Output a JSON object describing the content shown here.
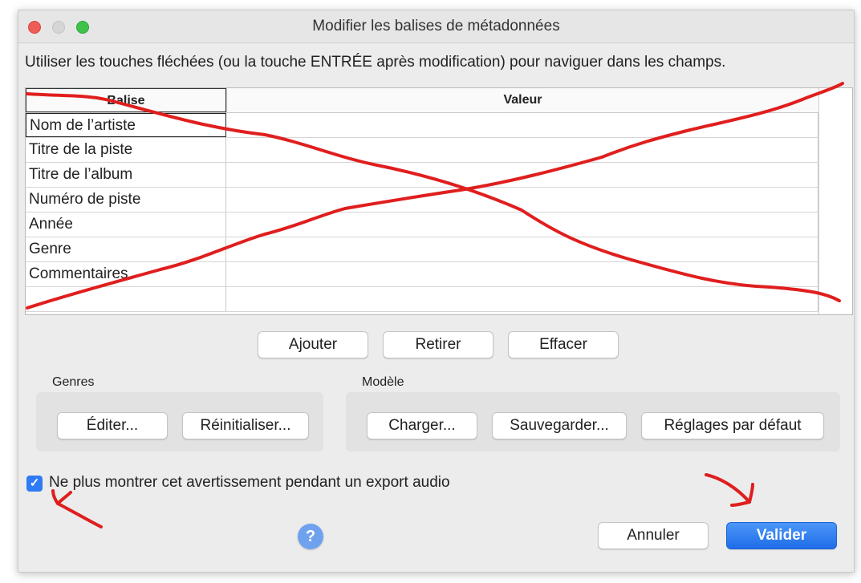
{
  "window": {
    "title": "Modifier les balises de métadonnées"
  },
  "instructions": "Utiliser les touches fléchées (ou la touche ENTRÉE après modification) pour naviguer dans les champs.",
  "table": {
    "headers": {
      "tag": "Balise",
      "value": "Valeur"
    },
    "rows": [
      {
        "tag": "Nom de l’artiste",
        "value": ""
      },
      {
        "tag": "Titre de la piste",
        "value": ""
      },
      {
        "tag": "Titre de l’album",
        "value": ""
      },
      {
        "tag": "Numéro de piste",
        "value": ""
      },
      {
        "tag": "Année",
        "value": ""
      },
      {
        "tag": "Genre",
        "value": ""
      },
      {
        "tag": "Commentaires",
        "value": ""
      },
      {
        "tag": "",
        "value": ""
      }
    ]
  },
  "table_buttons": {
    "add": "Ajouter",
    "remove": "Retirer",
    "clear": "Effacer"
  },
  "genres": {
    "label": "Genres",
    "edit": "Éditer...",
    "reset": "Réinitialiser..."
  },
  "template": {
    "label": "Modèle",
    "load": "Charger...",
    "save": "Sauvegarder...",
    "defaults": "Réglages par défaut"
  },
  "dont_show": {
    "checked": true,
    "label": "Ne plus montrer cet avertissement pendant un export audio"
  },
  "help": "?",
  "footer": {
    "cancel": "Annuler",
    "ok": "Valider"
  },
  "colors": {
    "accent": "#2f7bf5",
    "annotation": "#e01e1e",
    "primary_button": "#1f6de9"
  }
}
